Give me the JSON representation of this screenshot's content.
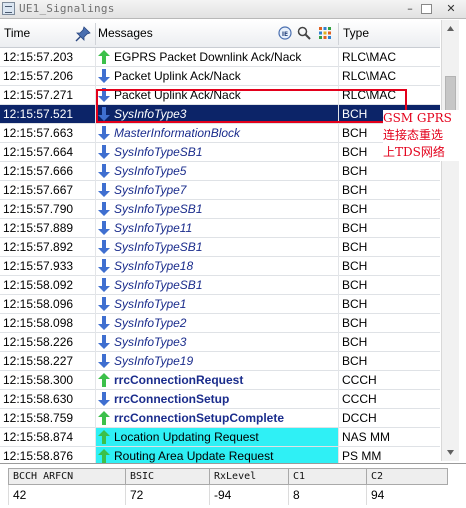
{
  "window": {
    "title": "UE1_Signalings"
  },
  "header": {
    "time": "Time",
    "messages": "Messages",
    "type": "Type"
  },
  "rows": [
    {
      "time": "12:15:57.203",
      "dir": "up",
      "style": "normal",
      "message": "EGPRS Packet Downlink Ack/Nack",
      "type": "RLC\\MAC"
    },
    {
      "time": "12:15:57.206",
      "dir": "down",
      "style": "normal",
      "message": "Packet Uplink Ack/Nack",
      "type": "RLC\\MAC"
    },
    {
      "time": "12:15:57.271",
      "dir": "down",
      "style": "normal",
      "message": "Packet Uplink Ack/Nack",
      "type": "RLC\\MAC"
    },
    {
      "time": "12:15:57.521",
      "dir": "down",
      "style": "italic",
      "message": "SysInfoType3",
      "type": "BCH",
      "selected": true
    },
    {
      "time": "12:15:57.663",
      "dir": "down",
      "style": "italic",
      "message": "MasterInformationBlock",
      "type": "BCH"
    },
    {
      "time": "12:15:57.664",
      "dir": "down",
      "style": "italic",
      "message": "SysInfoTypeSB1",
      "type": "BCH"
    },
    {
      "time": "12:15:57.666",
      "dir": "down",
      "style": "italic",
      "message": "SysInfoType5",
      "type": "BCH"
    },
    {
      "time": "12:15:57.667",
      "dir": "down",
      "style": "italic",
      "message": "SysInfoType7",
      "type": "BCH"
    },
    {
      "time": "12:15:57.790",
      "dir": "down",
      "style": "italic",
      "message": "SysInfoTypeSB1",
      "type": "BCH"
    },
    {
      "time": "12:15:57.889",
      "dir": "down",
      "style": "italic",
      "message": "SysInfoType11",
      "type": "BCH"
    },
    {
      "time": "12:15:57.892",
      "dir": "down",
      "style": "italic",
      "message": "SysInfoTypeSB1",
      "type": "BCH"
    },
    {
      "time": "12:15:57.933",
      "dir": "down",
      "style": "italic",
      "message": "SysInfoType18",
      "type": "BCH"
    },
    {
      "time": "12:15:58.092",
      "dir": "down",
      "style": "italic",
      "message": "SysInfoTypeSB1",
      "type": "BCH"
    },
    {
      "time": "12:15:58.096",
      "dir": "down",
      "style": "italic",
      "message": "SysInfoType1",
      "type": "BCH"
    },
    {
      "time": "12:15:58.098",
      "dir": "down",
      "style": "italic",
      "message": "SysInfoType2",
      "type": "BCH"
    },
    {
      "time": "12:15:58.226",
      "dir": "down",
      "style": "italic",
      "message": "SysInfoType3",
      "type": "BCH"
    },
    {
      "time": "12:15:58.227",
      "dir": "down",
      "style": "italic",
      "message": "SysInfoType19",
      "type": "BCH"
    },
    {
      "time": "12:15:58.300",
      "dir": "up",
      "style": "bold",
      "message": "rrcConnectionRequest",
      "type": "CCCH"
    },
    {
      "time": "12:15:58.630",
      "dir": "down",
      "style": "bold",
      "message": "rrcConnectionSetup",
      "type": "CCCH"
    },
    {
      "time": "12:15:58.759",
      "dir": "up",
      "style": "bold",
      "message": "rrcConnectionSetupComplete",
      "type": "DCCH"
    },
    {
      "time": "12:15:58.874",
      "dir": "up",
      "style": "highlight",
      "message": "Location Updating Request",
      "type": "NAS MM"
    },
    {
      "time": "12:15:58.876",
      "dir": "up",
      "style": "highlight",
      "message": "Routing Area Update Request",
      "type": "PS MM"
    }
  ],
  "annotation": {
    "lines": [
      "GSM GPRS",
      "连接态重选",
      "上TDS网络"
    ],
    "color": "#e3001b"
  },
  "cell_table": {
    "headers": [
      "BCCH ARFCN",
      "BSIC",
      "RxLevel",
      "C1",
      "C2"
    ],
    "values": [
      "42",
      "72",
      "-94",
      "8",
      "94"
    ]
  },
  "colors": {
    "selected_row": "#0c2468",
    "highlight_row": "#2ff0f5",
    "arrow_up": "#3cc04a",
    "arrow_down": "#3f6fd0"
  },
  "icons": {
    "pin": "pin-icon",
    "filter": "filter-icon",
    "search": "search-icon",
    "columns": "columns-icon",
    "arrow_up": "arrow-up-icon",
    "arrow_down": "arrow-down-icon"
  }
}
